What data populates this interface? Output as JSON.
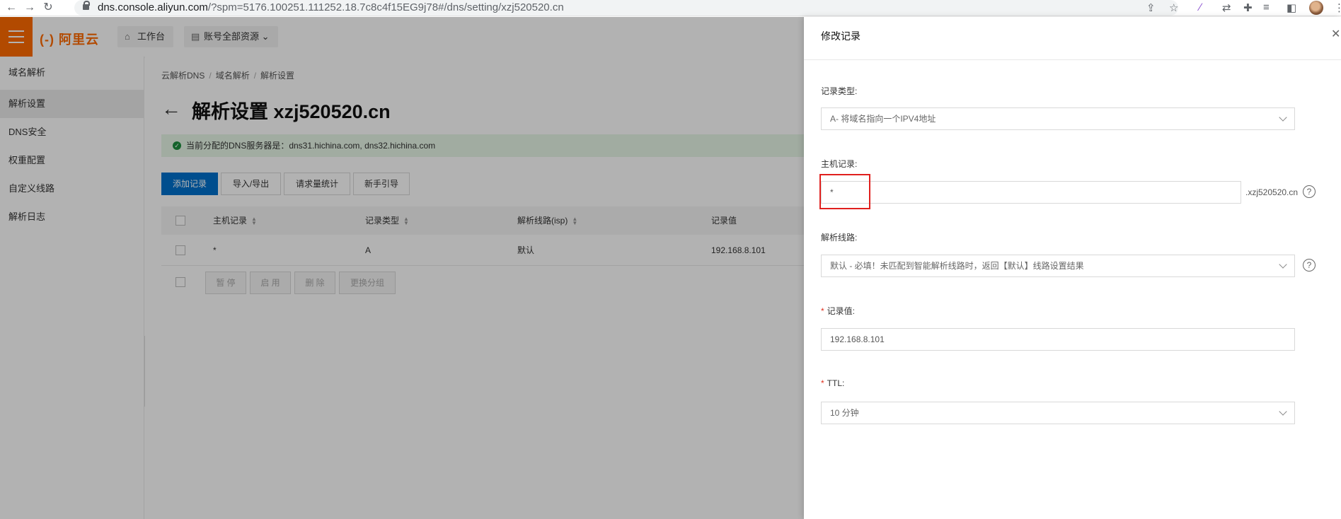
{
  "browser": {
    "url_host": "dns.console.aliyun.com",
    "url_path": "/?spm=5176.100251.111252.18.7c8c4f15EG9j78#/dns/setting/xzj520520.cn"
  },
  "topbar": {
    "logo": "(-) 阿里云",
    "workbench": "工作台",
    "resources": "账号全部资源"
  },
  "sidebar": {
    "items": [
      {
        "label": "域名解析"
      },
      {
        "label": "解析设置"
      },
      {
        "label": "DNS安全"
      },
      {
        "label": "权重配置"
      },
      {
        "label": "自定义线路"
      },
      {
        "label": "解析日志"
      }
    ]
  },
  "main": {
    "breadcrumb": [
      "云解析DNS",
      "域名解析",
      "解析设置"
    ],
    "title": "解析设置 xzj520520.cn",
    "alert": "当前分配的DNS服务器是：dns31.hichina.com, dns32.hichina.com",
    "actions": [
      "添加记录",
      "导入/导出",
      "请求量统计",
      "新手引导"
    ],
    "table": {
      "headers": [
        "主机记录",
        "记录类型",
        "解析线路(isp)",
        "记录值"
      ],
      "rows": [
        {
          "host": "*",
          "type": "A",
          "line": "默认",
          "value": "192.168.8.101"
        }
      ]
    },
    "bulk_actions": [
      "暂 停",
      "启 用",
      "删 除",
      "更换分组"
    ]
  },
  "drawer": {
    "title": "修改记录",
    "record_type_label": "记录类型:",
    "record_type_value": "A- 将域名指向一个IPV4地址",
    "host_label": "主机记录:",
    "host_value": "*",
    "host_suffix": ".xzj520520.cn",
    "line_label": "解析线路:",
    "line_value": "默认 - 必填！未匹配到智能解析线路时，返回【默认】线路设置结果",
    "value_label": "记录值:",
    "value_value": "192.168.8.101",
    "ttl_label": "TTL:",
    "ttl_value": "10 分钟"
  },
  "colors": {
    "brand": "#ff6a00",
    "primary": "#0070cc",
    "highlight": "#e0201e"
  }
}
